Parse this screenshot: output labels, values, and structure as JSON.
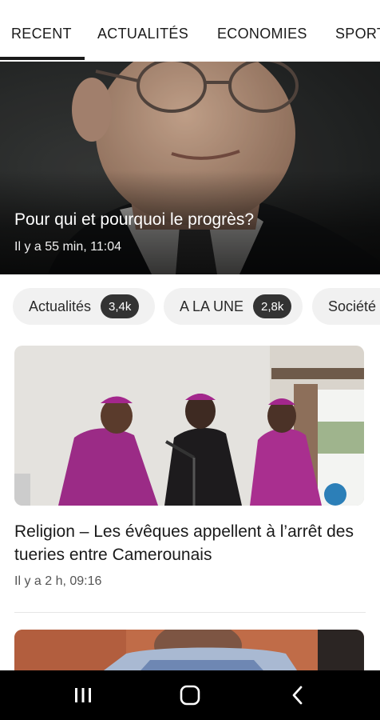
{
  "tabs": [
    {
      "label": "RECENT",
      "active": true
    },
    {
      "label": "ACTUALITÉS"
    },
    {
      "label": "ECONOMIES"
    },
    {
      "label": "SPORTS"
    }
  ],
  "hero": {
    "title": "Pour qui et pourquoi le progrès?",
    "time": "Il y a 55 min, 11:04"
  },
  "chips": [
    {
      "label": "Actualités",
      "count": "3,4k"
    },
    {
      "label": "A LA UNE",
      "count": "2,8k"
    },
    {
      "label": "Société",
      "count": ""
    }
  ],
  "article": {
    "title": "Religion – Les évêques appellent à l’arrêt des tueries entre Camerounais",
    "time": "Il y a 2 h, 09:16"
  },
  "nav": {
    "recent_icon": "recent-apps-icon",
    "home_icon": "home-icon",
    "back_icon": "back-icon"
  },
  "colors": {
    "chip_bg": "#f1f1f1",
    "chip_count_bg": "#333333",
    "navbar": "#000000"
  }
}
